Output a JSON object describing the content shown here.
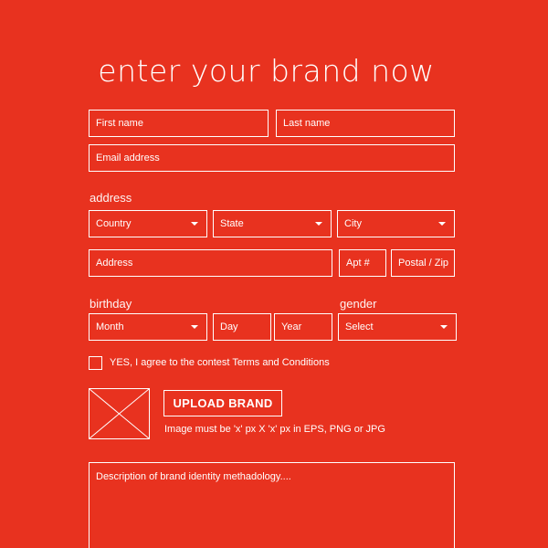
{
  "header": {
    "title": "enter your brand now"
  },
  "form": {
    "first_name": {
      "placeholder": "First name"
    },
    "last_name": {
      "placeholder": "Last name"
    },
    "email": {
      "placeholder": "Email address"
    },
    "address_section": {
      "label": "address",
      "country": {
        "selected": "Country"
      },
      "state": {
        "selected": "State"
      },
      "city": {
        "selected": "City"
      },
      "address": {
        "placeholder": "Address"
      },
      "apt": {
        "placeholder": "Apt #"
      },
      "postal": {
        "placeholder": "Postal / Zip"
      }
    },
    "birthday_section": {
      "label": "birthday",
      "month": {
        "selected": "Month"
      },
      "day": {
        "placeholder": "Day"
      },
      "year": {
        "placeholder": "Year"
      }
    },
    "gender_section": {
      "label": "gender",
      "gender": {
        "selected": "Select"
      }
    },
    "terms": {
      "label": "YES, I agree to the contest Terms and Conditions",
      "checked": false
    },
    "upload": {
      "button_label": "UPLOAD BRAND",
      "hint": "Image must be 'x' px X 'x' px in EPS, PNG or JPG"
    },
    "description": {
      "placeholder": "Description of brand identity methadology...."
    }
  },
  "colors": {
    "background": "#e8321f",
    "foreground": "#ffffff"
  },
  "icons": {
    "dropdown": "chevron-down-icon",
    "image_placeholder": "image-placeholder-icon"
  }
}
